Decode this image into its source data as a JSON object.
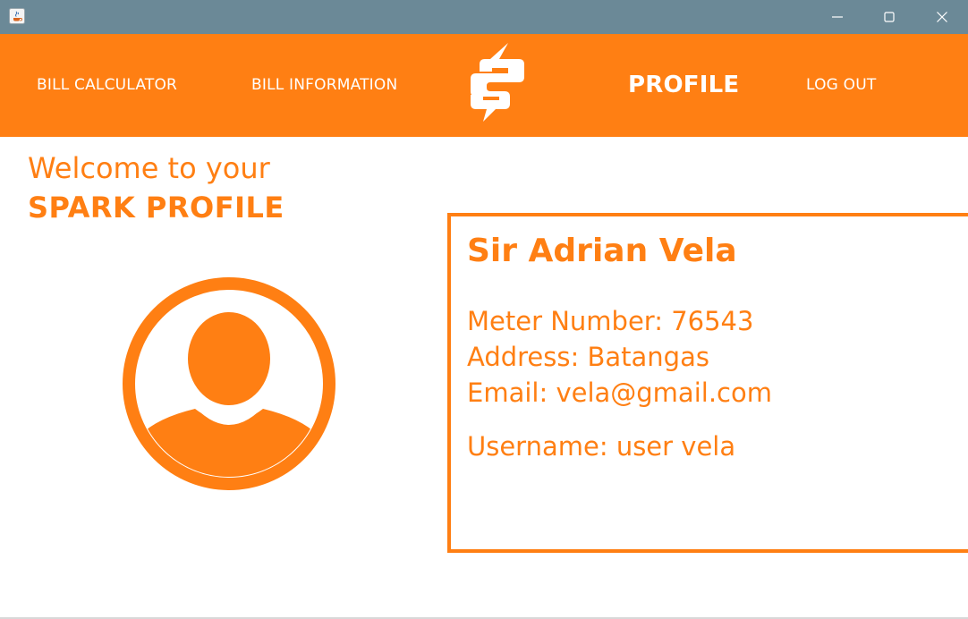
{
  "window": {
    "icon": "java-cup-icon",
    "controls": [
      "minimize-icon",
      "maximize-icon",
      "close-icon"
    ]
  },
  "nav": {
    "bill_calculator": "BILL CALCULATOR",
    "bill_information": "BILL INFORMATION",
    "logo": "spark-bolt-icon",
    "profile": "PROFILE",
    "logout": "LOG OUT"
  },
  "welcome": {
    "line1": "Welcome to your",
    "line2": "SPARK PROFILE"
  },
  "avatar": "user-avatar-icon",
  "profile": {
    "name": "Sir Adrian Vela",
    "meter": "Meter Number: 76543",
    "address": "Address: Batangas",
    "email": "Email: vela@gmail.com",
    "username": "Username: user vela"
  },
  "colors": {
    "accent": "#ff7f13",
    "titlebar": "#6b8997",
    "background": "#ffffff"
  }
}
